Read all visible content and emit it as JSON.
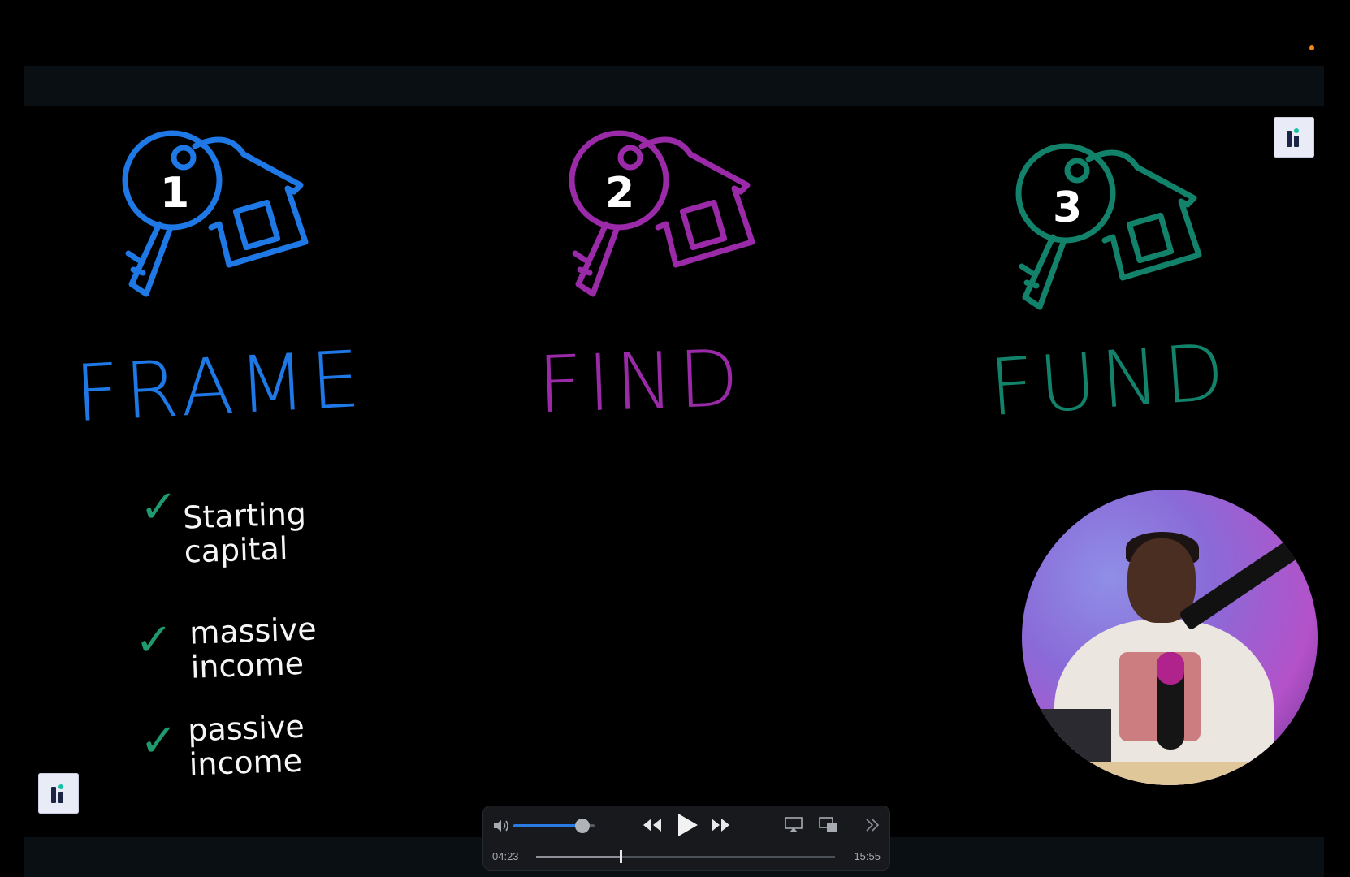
{
  "steps": [
    {
      "number": "1",
      "title": "FRAME",
      "color": "#1e78e6"
    },
    {
      "number": "2",
      "title": "FIND",
      "color": "#9a2aa8"
    },
    {
      "number": "3",
      "title": "FUND",
      "color": "#13826a"
    }
  ],
  "checklist": [
    {
      "line1": "Starting",
      "line2": "capital"
    },
    {
      "line1": "massive",
      "line2": "income"
    },
    {
      "line1": "passive",
      "line2": "income"
    }
  ],
  "checkmark_glyph": "✓",
  "player": {
    "current_time": "04:23",
    "total_time": "15:55",
    "volume_level": 0.85,
    "progress_fraction": 0.282
  },
  "colors": {
    "accent": "#2a7ae4",
    "check": "#1f9a6e",
    "record_dot": "#f28a18"
  }
}
